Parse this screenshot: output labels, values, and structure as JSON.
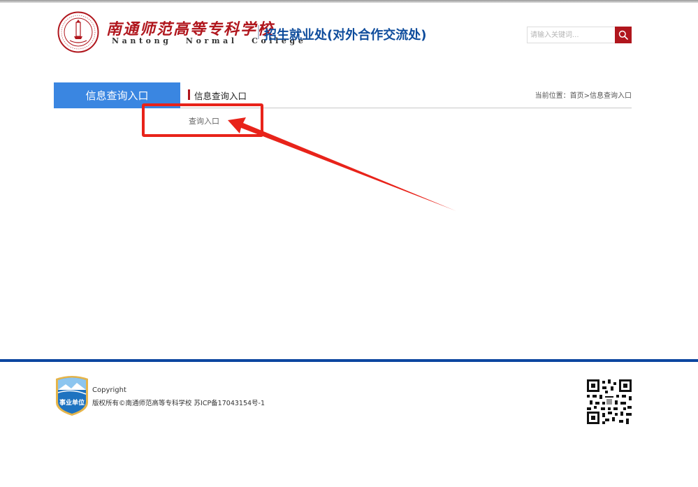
{
  "header": {
    "logo_cn": "南通师范高等专科学校",
    "logo_en": "Nantong Normal College",
    "department": "招生就业处(对外合作交流处)",
    "search_placeholder": "请输入关键词..."
  },
  "sidebar": {
    "title": "信息查询入口"
  },
  "content": {
    "title": "信息查询入口",
    "breadcrumb_prefix": "当前位置：",
    "breadcrumb_home": "首页",
    "breadcrumb_sep": ">",
    "breadcrumb_current": "信息查询入口",
    "items": [
      {
        "label": "查询入口"
      }
    ]
  },
  "annotation": {
    "color": "#e8231a"
  },
  "footer": {
    "badge_label": "事业单位",
    "copyright_title": "Copyright",
    "copyright_text": "版权所有©南通师范高等专科学校 苏ICP备17043154号-1"
  },
  "colors": {
    "brand_red": "#b0161d",
    "brand_blue": "#0e4c9c",
    "sidebar_blue": "#3a86e1",
    "footer_blue": "#0c46a0"
  }
}
